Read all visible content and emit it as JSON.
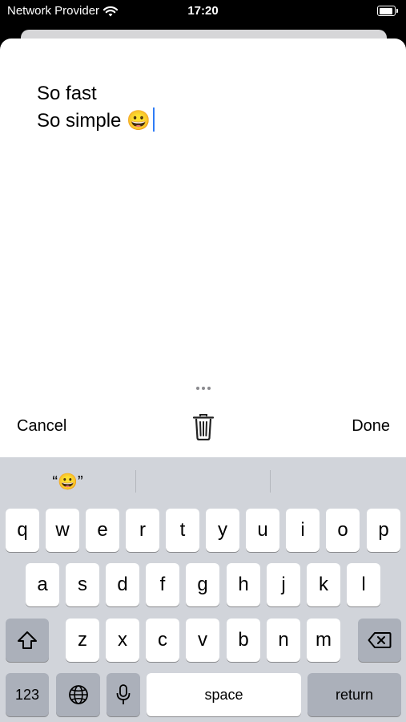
{
  "status_bar": {
    "carrier": "Network Provider",
    "time": "17:20",
    "battery_level": 1.0
  },
  "note": {
    "lines": [
      "So fast",
      "So simple 😀"
    ]
  },
  "toolbar": {
    "cancel_label": "Cancel",
    "done_label": "Done",
    "trash_icon": "trash-icon"
  },
  "keyboard": {
    "suggestions": [
      "“😀”",
      "",
      ""
    ],
    "row1": [
      "q",
      "w",
      "e",
      "r",
      "t",
      "y",
      "u",
      "i",
      "o",
      "p"
    ],
    "row2": [
      "a",
      "s",
      "d",
      "f",
      "g",
      "h",
      "j",
      "k",
      "l"
    ],
    "row3": [
      "z",
      "x",
      "c",
      "v",
      "b",
      "n",
      "m"
    ],
    "numbers_label": "123",
    "space_label": "space",
    "return_label": "return"
  },
  "colors": {
    "caret": "#2f7cf6",
    "keyboard_bg": "#d1d4da",
    "key_dark": "#abb0ba"
  }
}
